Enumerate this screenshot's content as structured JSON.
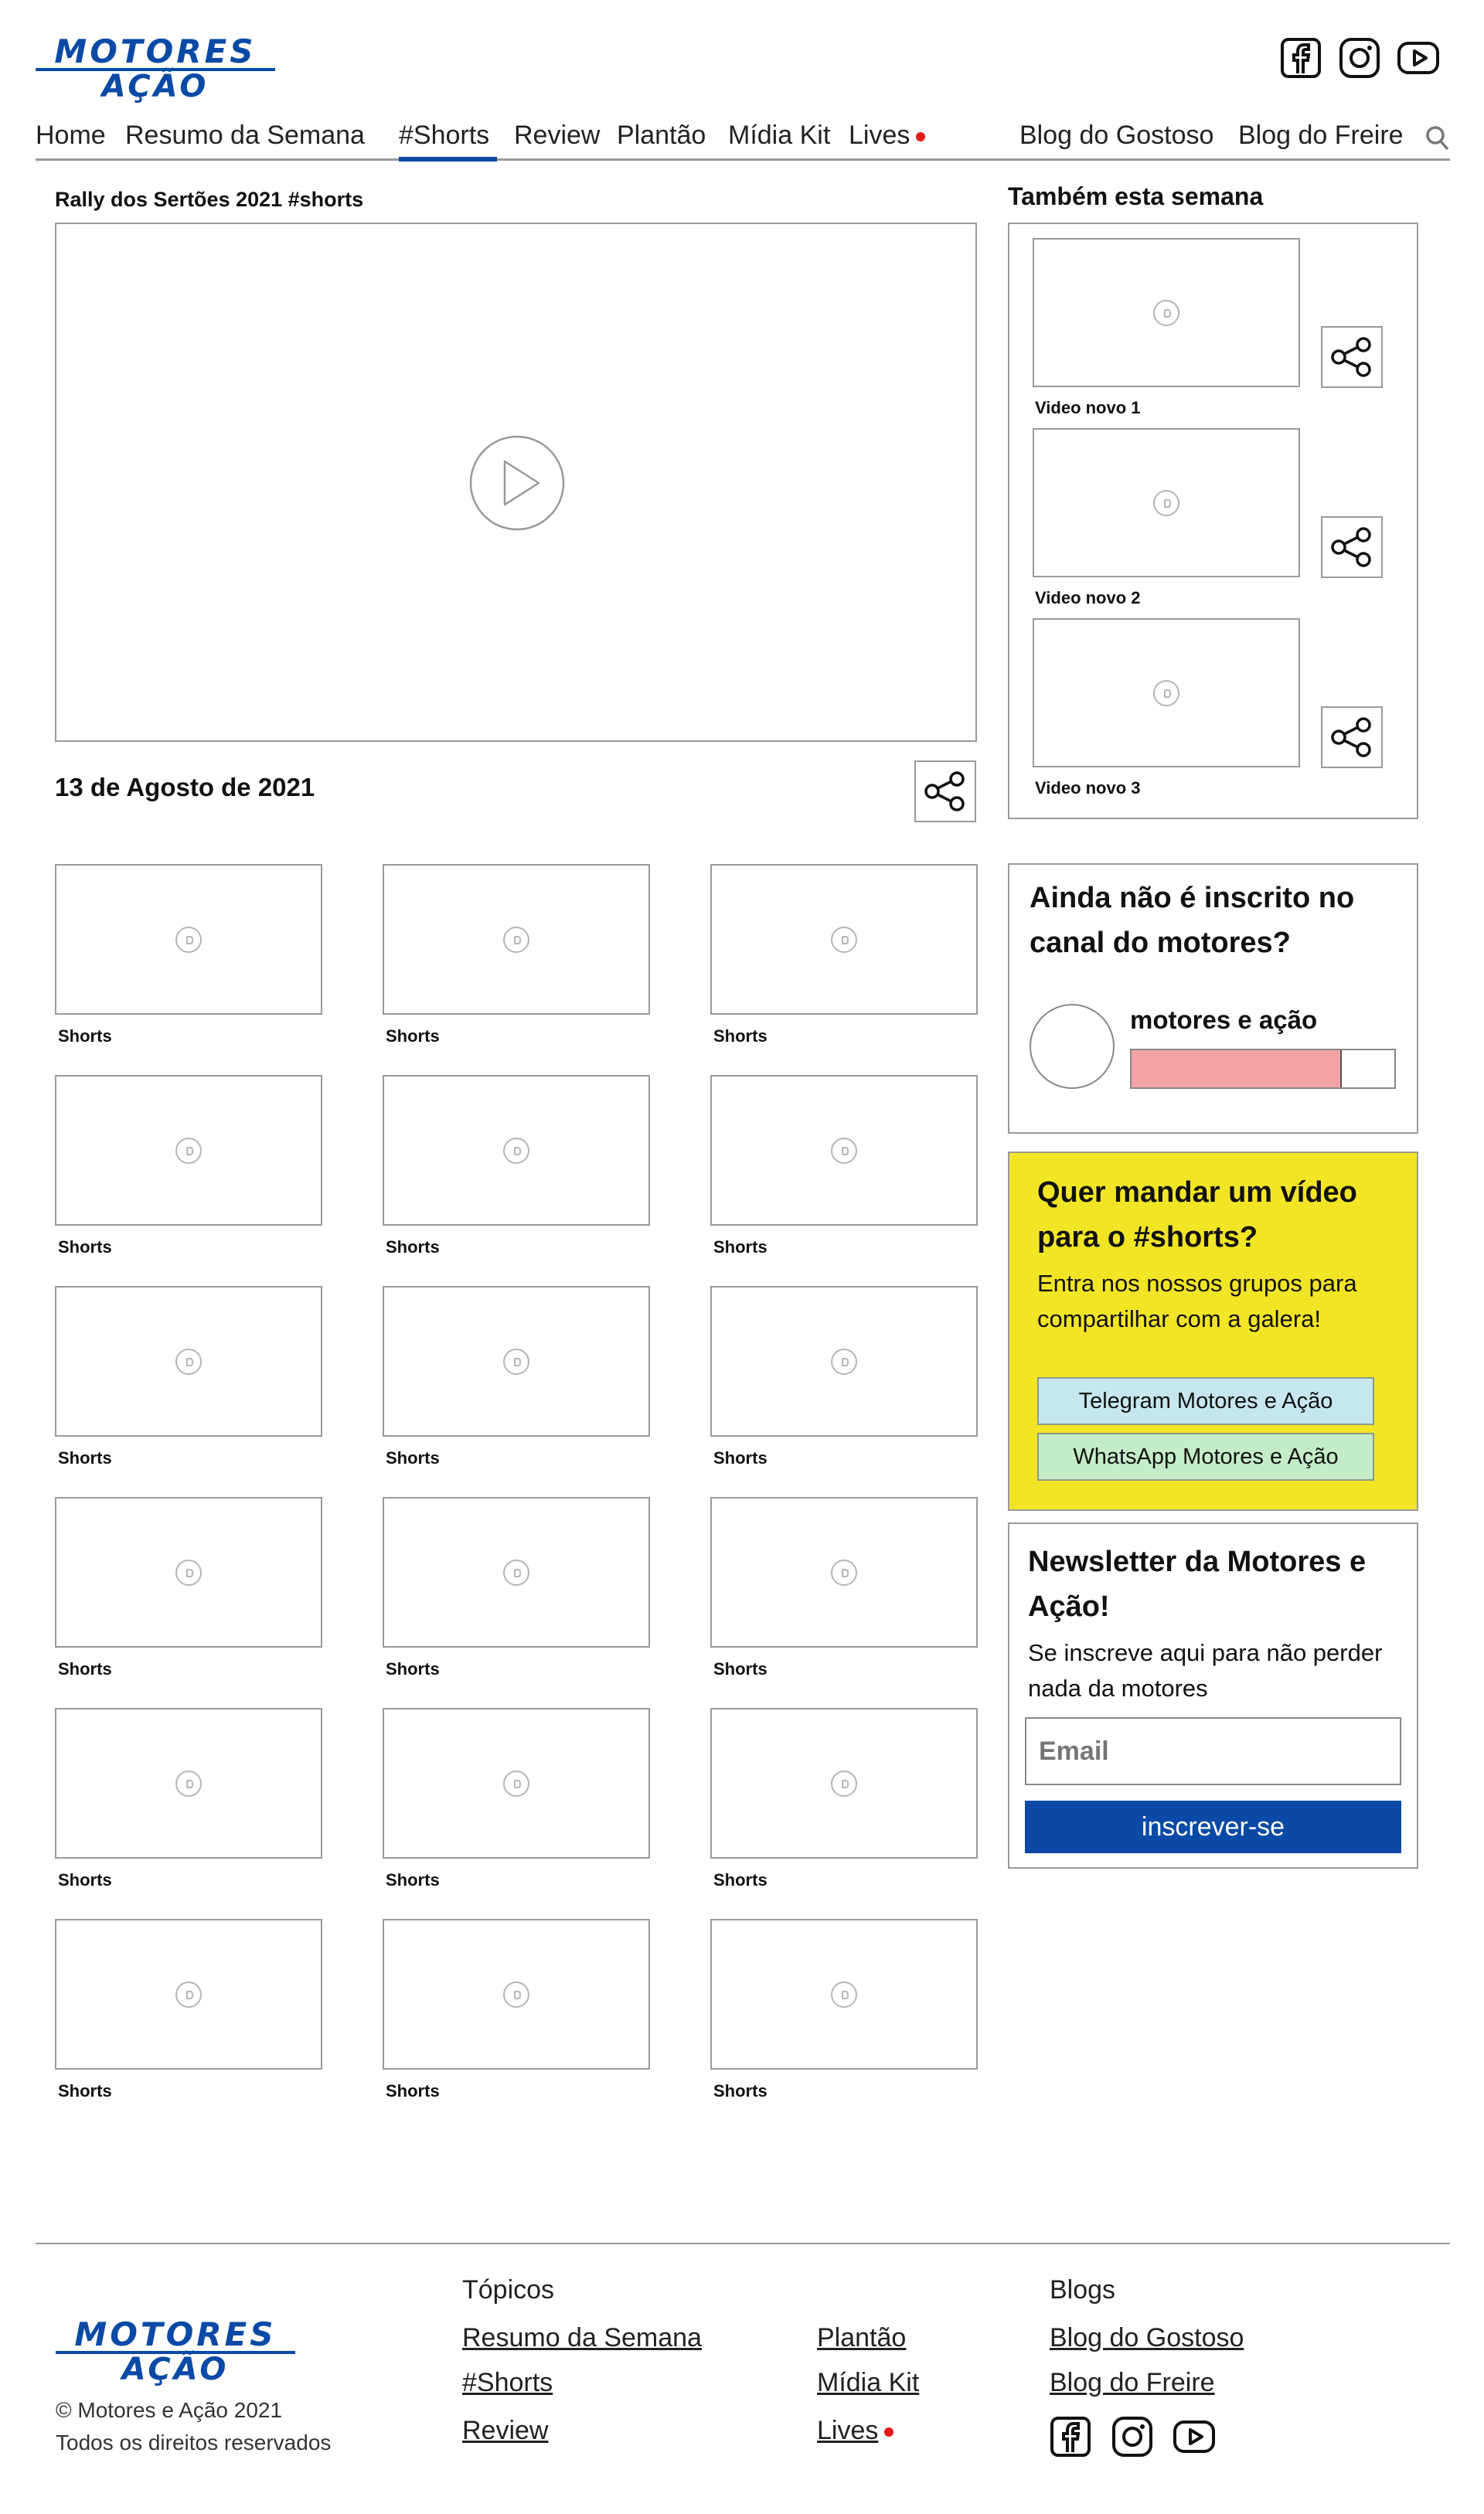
{
  "brand": {
    "logo_line1": "MOTORES",
    "logo_line2": "AÇÃO",
    "accent": "#0a4aa6"
  },
  "header": {
    "social_icons": [
      "facebook-icon",
      "instagram-icon",
      "youtube-icon"
    ]
  },
  "nav": {
    "items": [
      "Home",
      "Resumo da Semana",
      "#Shorts",
      "Review",
      "Plantão",
      "Mídia Kit",
      "Lives"
    ],
    "active": "#Shorts",
    "blogs": [
      "Blog do Gostoso",
      "Blog do Freire"
    ]
  },
  "main": {
    "video_title": "Rally dos Sertões 2021 #shorts",
    "date": "13 de Agosto de 2021",
    "grid_label": "Shorts",
    "grid_count": 18
  },
  "sidebar": {
    "week_title": "Também esta semana",
    "week_videos": [
      "Video novo 1",
      "Video novo 2",
      "Video novo 3"
    ],
    "subscribe": {
      "title": "Ainda não é inscrito no canal do motores?",
      "channel": "motores e ação",
      "progress": 0.8,
      "progress_color": "#f4a4a4"
    },
    "submit": {
      "title": "Quer mandar um vídeo para o #shorts?",
      "text": "Entra nos nossos grupos para compartilhar com a galera!",
      "telegram": "Telegram Motores e Ação",
      "whatsapp": "WhatsApp Motores e Ação",
      "bg": "#f2e526",
      "telegram_bg": "#c6e7ee",
      "whatsapp_bg": "#c4ecc8"
    },
    "newsletter": {
      "title": "Newsletter da Motores e Ação!",
      "text": "Se inscreve aqui para não perder nada da motores",
      "placeholder": "Email",
      "button": "inscrever-se"
    }
  },
  "footer": {
    "copyright": "© Motores e Ação 2021",
    "rights": "Todos os direitos reservados",
    "topics_title": "Tópicos",
    "topics_col1": [
      "Resumo da Semana",
      "#Shorts",
      "Review"
    ],
    "topics_col2": [
      "Plantão",
      "Mídia Kit",
      "Lives"
    ],
    "blogs_title": "Blogs",
    "blogs": [
      "Blog do Gostoso",
      "Blog do Freire"
    ]
  }
}
